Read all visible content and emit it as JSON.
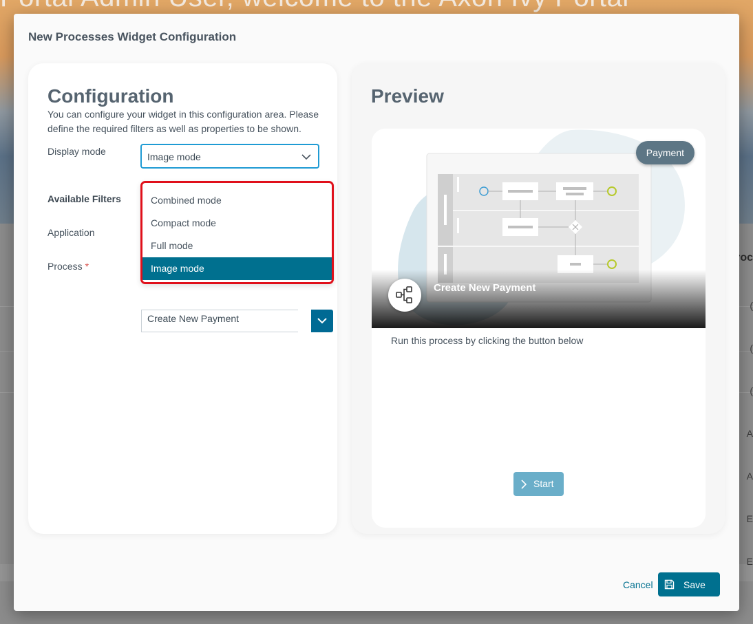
{
  "background": {
    "hero_title": "Portal Admin User, welcome to the Axon Ivy Portal",
    "right_fragments": [
      "roc",
      "(",
      "(",
      "(",
      "A",
      "A",
      "E",
      "E"
    ]
  },
  "dialog": {
    "title": "New Processes Widget Configuration"
  },
  "config": {
    "heading": "Configuration",
    "description": "You can configure your widget in this configuration area. Please define the required filters as well as properties to be shown.",
    "display_mode_label": "Display mode",
    "display_mode_value": "Image mode",
    "display_mode_options": [
      "Combined mode",
      "Compact mode",
      "Full mode",
      "Image mode"
    ],
    "available_filters_label": "Available Filters",
    "application_label": "Application",
    "process_label": "Process",
    "process_required_mark": "*",
    "process_value": "Create New Payment"
  },
  "preview": {
    "heading": "Preview",
    "card": {
      "badge": "Payment",
      "name": "Create New Payment",
      "description": "Run this process by clicking the button below",
      "start_label": "Start"
    }
  },
  "footer": {
    "cancel_label": "Cancel",
    "save_label": "Save"
  },
  "colors": {
    "primary": "#00708f",
    "focus_border": "#1f9bd4",
    "highlight_border": "#e0101b",
    "start_button": "#6aaec9",
    "badge": "#5d7685"
  },
  "icons": [
    "chevron-down-icon",
    "process-flow-icon",
    "chevron-right-icon",
    "save-icon"
  ]
}
